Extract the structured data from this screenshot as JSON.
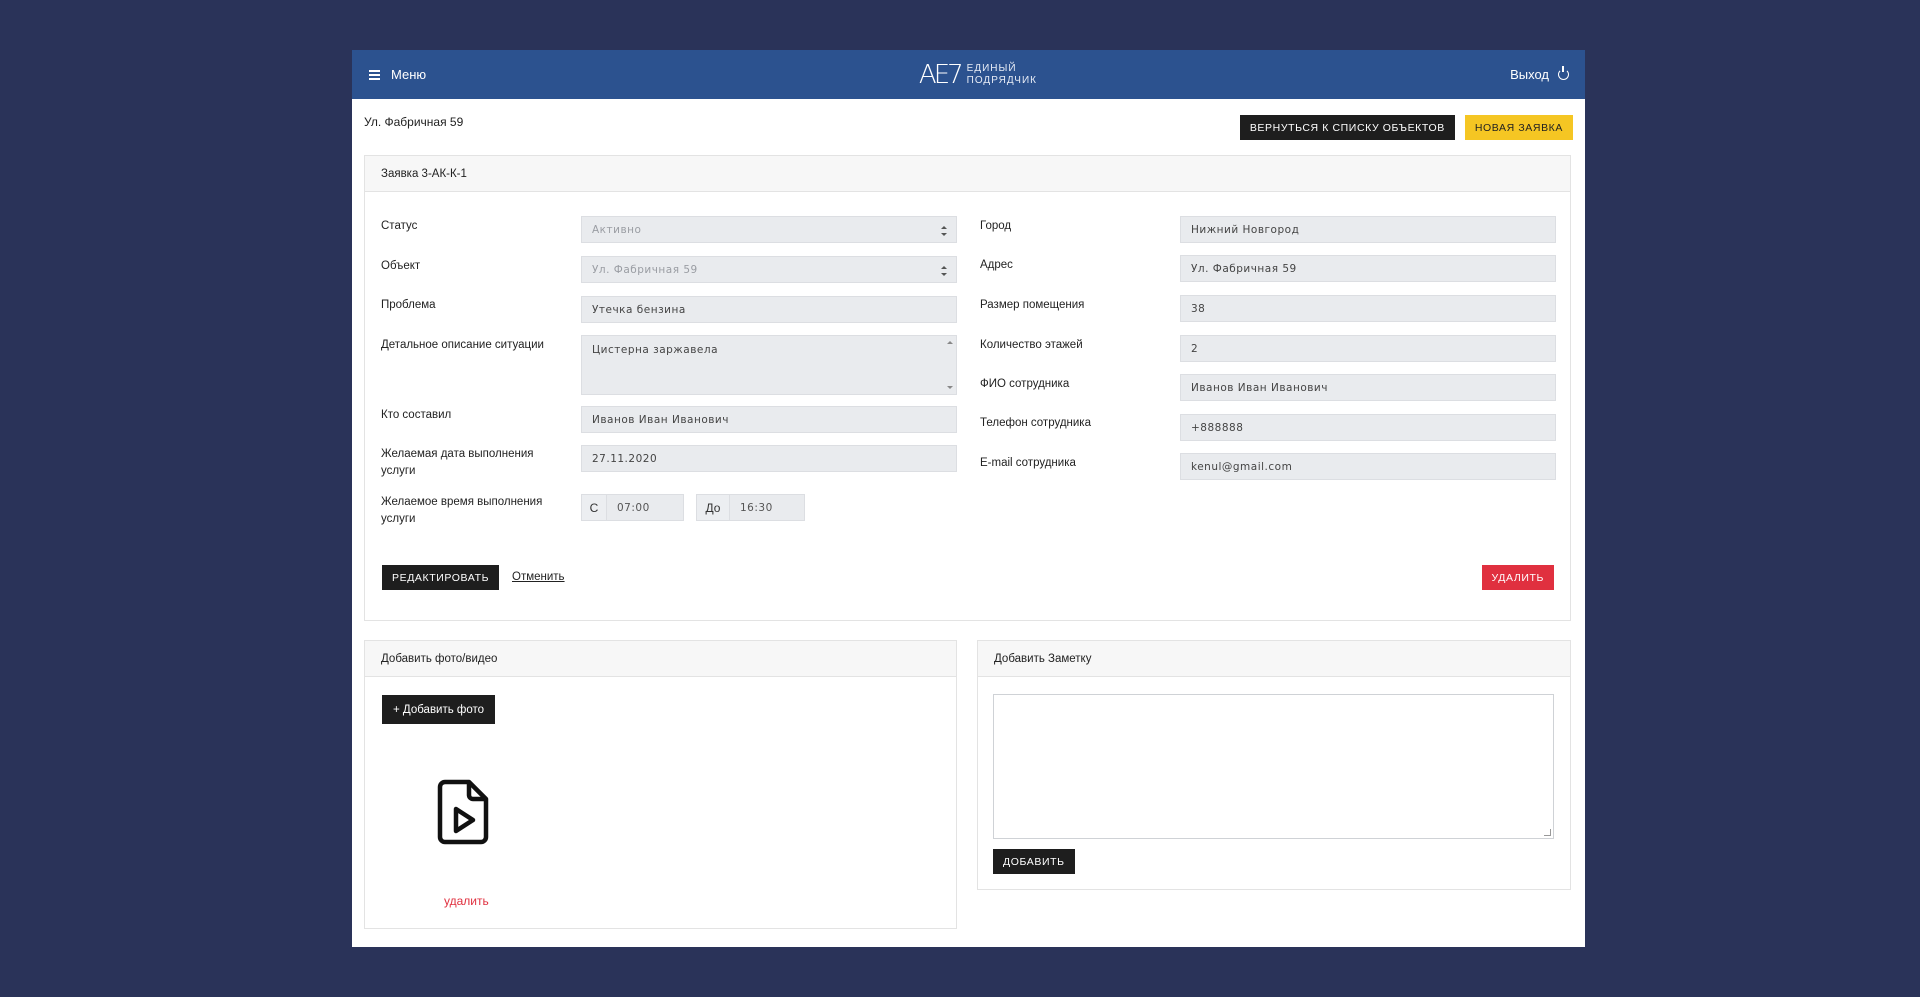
{
  "header": {
    "menu_label": "Меню",
    "logo_mark": "АЕ7",
    "logo_line1": "ЕДИНЫЙ",
    "logo_line2": "ПОДРЯДЧИК",
    "logout_label": "Выход"
  },
  "breadcrumb": "Ул. Фабричная 59",
  "actions": {
    "back_label": "ВЕРНУТЬСЯ К СПИСКУ ОБЪЕКТОВ",
    "new_request_label": "НОВАЯ ЗАЯВКА"
  },
  "request": {
    "title": "Заявка 3-АК-К-1",
    "left": {
      "status_label": "Статус",
      "status_value": "Активно",
      "object_label": "Объект",
      "object_value": "Ул. Фабричная 59",
      "problem_label": "Проблема",
      "problem_value": "Утечка бензина",
      "description_label": "Детальное описание ситуации",
      "description_value": "Цистерна заржавела",
      "author_label": "Кто составил",
      "author_value": "Иванов Иван Иванович",
      "date_label": "Желаемая дата выполнения услуги",
      "date_value": "27.11.2020",
      "time_label": "Желаемое время выполнения услуги",
      "time_from_prefix": "С",
      "time_from": "07:00",
      "time_to_prefix": "До",
      "time_to": "16:30"
    },
    "right": {
      "city_label": "Город",
      "city_value": "Нижний Новгород",
      "address_label": "Адрес",
      "address_value": "Ул. Фабричная 59",
      "room_size_label": "Размер помещения",
      "room_size_value": "38",
      "floors_label": "Количество этажей",
      "floors_value": "2",
      "employee_label": "ФИО сотрудника",
      "employee_value": "Иванов Иван Иванович",
      "phone_label": "Телефон сотрудника",
      "phone_value": "+888888",
      "email_label": "E-mail сотрудника",
      "email_value": "kenul@gmail.com"
    },
    "edit_label": "РЕДАКТИРОВАТЬ",
    "cancel_label": "Отменить",
    "delete_label": "УДАЛИТЬ"
  },
  "media": {
    "title": "Добавить фото/видео",
    "add_photo_label": "+ Добавить фото",
    "file_icon": "video-file-icon",
    "delete_label": "удалить"
  },
  "note": {
    "title": "Добавить Заметку",
    "value": "",
    "add_label": "ДОБАВИТЬ"
  },
  "colors": {
    "background": "#2a3359",
    "header": "#2c528f",
    "accent_yellow": "#f5c623",
    "danger": "#e0303f",
    "dark_button": "#1e1e1e"
  }
}
